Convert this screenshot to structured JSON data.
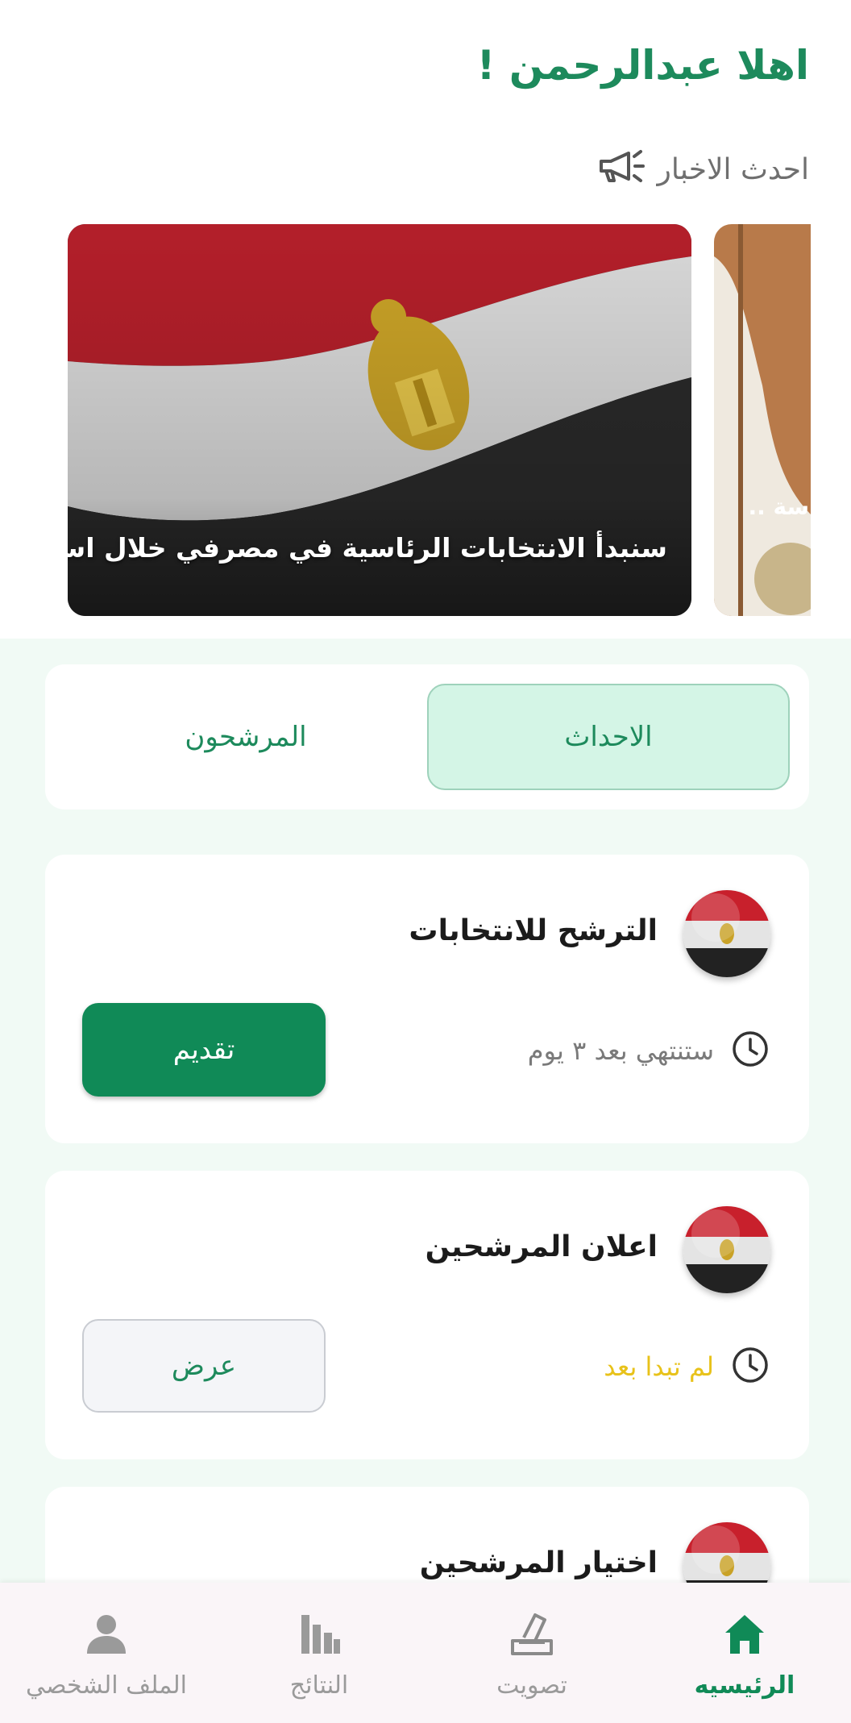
{
  "header": {
    "greeting": "اهلا  عبدالرحمن !",
    "news_heading": "احدث الاخبار",
    "news_icon": "megaphone-icon"
  },
  "news": {
    "items": [
      {
        "caption": "سنبدأ الانتخابات الرئاسية في مصرفي خلال اسبوع",
        "image": "egypt-flag"
      },
      {
        "caption": "سة ..",
        "image": "emblem"
      }
    ]
  },
  "tabs": [
    {
      "label": "الاحداث",
      "active": true
    },
    {
      "label": "المرشحون",
      "active": false
    }
  ],
  "events": [
    {
      "title": "الترشح للانتخابات",
      "status": "ستنتهي بعد ٣ يوم",
      "status_color": "#7a7a7a",
      "action": "تقديم",
      "action_style": "primary"
    },
    {
      "title": "اعلان المرشحين",
      "status": "لم تبدا بعد",
      "status_color": "#e8c21a",
      "action": "عرض",
      "action_style": "secondary"
    },
    {
      "title": "اختيار المرشحين"
    }
  ],
  "bottom_nav": [
    {
      "label": "الرئيسيه",
      "icon": "home-icon",
      "active": true
    },
    {
      "label": "تصويت",
      "icon": "vote-icon",
      "active": false
    },
    {
      "label": "النتائج",
      "icon": "results-icon",
      "active": false
    },
    {
      "label": "الملف الشخصي",
      "icon": "profile-icon",
      "active": false
    }
  ],
  "colors": {
    "brand": "#108a57",
    "accent_text": "#1d8a5c",
    "section_bg": "#f1faf5",
    "tab_active_bg": "#d4f5e6",
    "pending": "#e8c21a"
  }
}
